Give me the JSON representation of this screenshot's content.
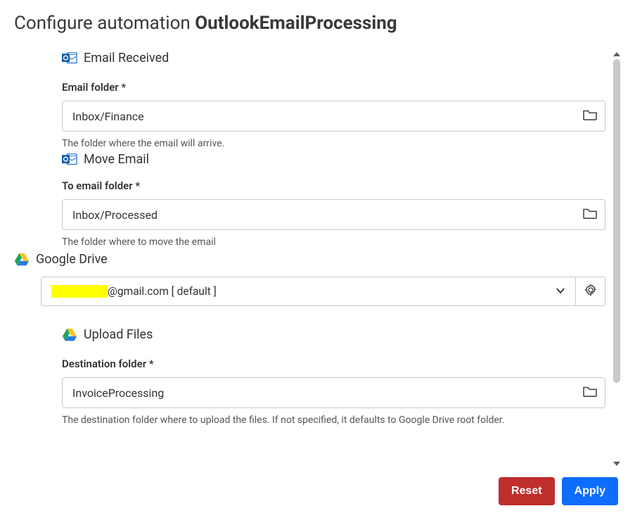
{
  "header": {
    "prefix": "Configure automation ",
    "name": "OutlookEmailProcessing"
  },
  "sections": {
    "emailReceived": {
      "title": "Email Received",
      "field_label": "Email folder *",
      "value": "Inbox/Finance",
      "helper": "The folder where the email will arrive."
    },
    "moveEmail": {
      "title": "Move Email",
      "field_label": "To email folder *",
      "value": "Inbox/Processed",
      "helper": "The folder where to move the email"
    },
    "googleDrive": {
      "title": "Google Drive",
      "account_suffix": "@gmail.com [ default ]"
    },
    "uploadFiles": {
      "title": "Upload Files",
      "field_label": "Destination folder *",
      "value": "InvoiceProcessing",
      "helper": "The destination folder where to upload the files. If not specified, it defaults to Google Drive root folder."
    }
  },
  "buttons": {
    "reset": "Reset",
    "apply": "Apply"
  }
}
